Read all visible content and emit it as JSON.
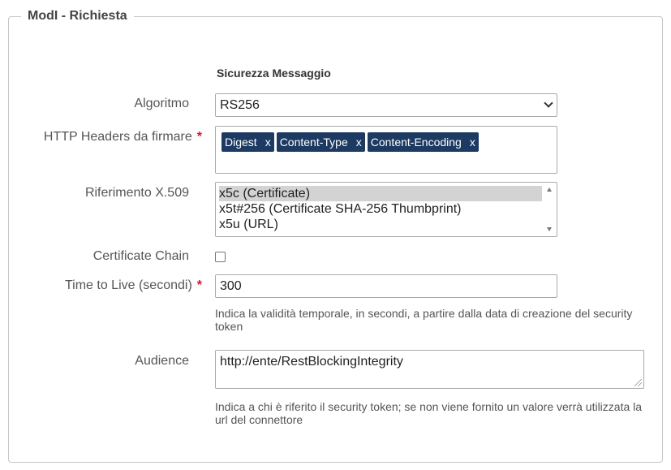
{
  "legend": "ModI - Richiesta",
  "section_title": "Sicurezza Messaggio",
  "fields": {
    "algoritmo": {
      "label": "Algoritmo",
      "value": "RS256"
    },
    "http_headers": {
      "label": "HTTP Headers da firmare",
      "required": "*",
      "tags": [
        "Digest",
        "Content-Type",
        "Content-Encoding"
      ],
      "remove_label": "x"
    },
    "riferimento": {
      "label": "Riferimento X.509",
      "options": [
        "x5c (Certificate)",
        "x5t#256 (Certificate SHA-256 Thumbprint)",
        "x5u (URL)"
      ]
    },
    "certificate_chain": {
      "label": "Certificate Chain"
    },
    "ttl": {
      "label": "Time to Live (secondi)",
      "required": "*",
      "value": "300",
      "hint": "Indica la validità temporale, in secondi, a partire dalla data di creazione del security token"
    },
    "audience": {
      "label": "Audience",
      "value": "http://ente/RestBlockingIntegrity",
      "hint": "Indica a chi è riferito il security token; se non viene fornito un valore verrà utilizzata la url del connettore"
    }
  }
}
